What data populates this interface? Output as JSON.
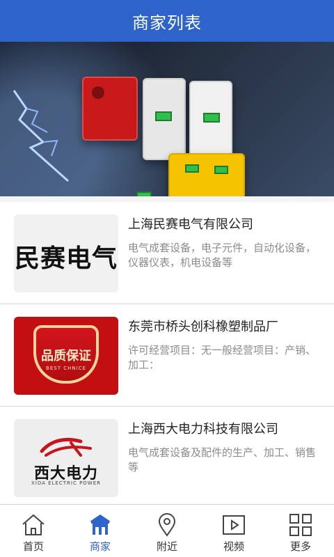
{
  "header": {
    "title": "商家列表"
  },
  "banner": {
    "dots": 2
  },
  "merchants": [
    {
      "name": "上海民赛电气有限公司",
      "desc": "电气成套设备，电子元件，自动化设备，仪器仪表，机电设备等",
      "thumb_text": "民赛电气"
    },
    {
      "name": "东莞市桥头创科橡塑制品厂",
      "desc": "许可经营项目：无一般经营项目：产销、加工：",
      "thumb_text": "品质保证",
      "thumb_subtext": "BEST CHNICE"
    },
    {
      "name": "上海西大电力科技有限公司",
      "desc": "电气成套设备及配件的生产、加工、销售等",
      "thumb_text": "西大电力",
      "thumb_subtext": "XIDA ELECTRIC POWER"
    }
  ],
  "bottom_nav": [
    {
      "label": "首页",
      "icon": "home-icon",
      "active": false
    },
    {
      "label": "商家",
      "icon": "store-icon",
      "active": true
    },
    {
      "label": "附近",
      "icon": "location-pin-icon",
      "active": false
    },
    {
      "label": "视频",
      "icon": "video-play-icon",
      "active": false
    },
    {
      "label": "更多",
      "icon": "grid-more-icon",
      "active": false
    }
  ],
  "colors": {
    "primary": "#2f63cc",
    "text": "#222222",
    "muted": "#8b8b8b"
  }
}
